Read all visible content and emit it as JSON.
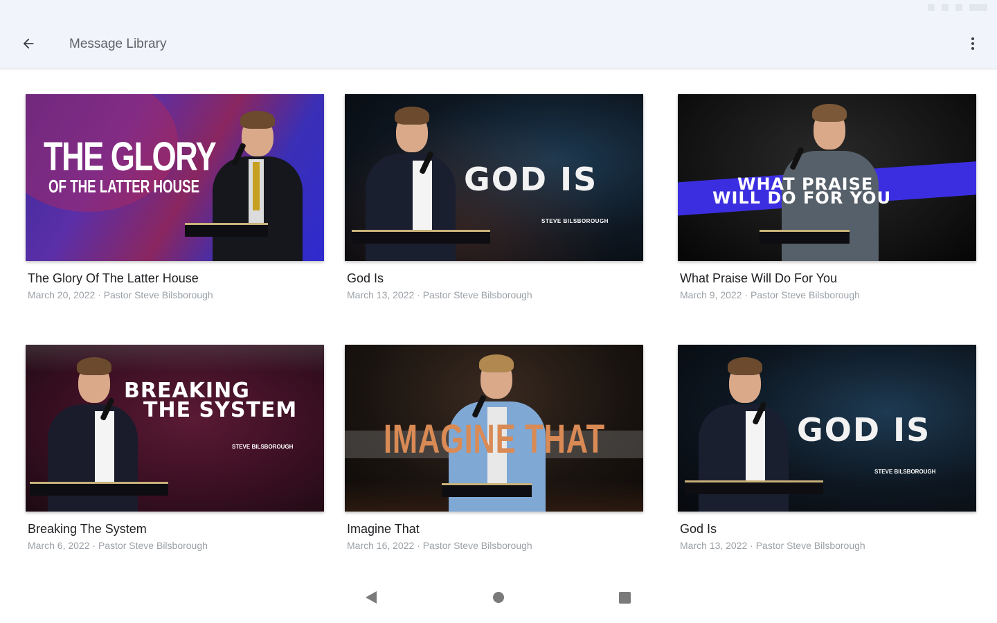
{
  "header": {
    "title": "Message Library"
  },
  "messages": [
    {
      "title": "The Glory Of The Latter House",
      "meta": "March 20, 2022 · Pastor Steve Bilsborough",
      "thumb_line1": "THE GLORY",
      "thumb_line2": "OF THE LATTER HOUSE"
    },
    {
      "title": "God Is",
      "meta": "March 13, 2022 · Pastor Steve Bilsborough",
      "thumb_line1": "GOD IS",
      "thumb_sub": "STEVE BILSBOROUGH"
    },
    {
      "title": "What Praise Will Do For You",
      "meta": "March 9, 2022 · Pastor Steve Bilsborough",
      "thumb_line1": "WHAT PRAISE",
      "thumb_line2": "WILL DO FOR YOU"
    },
    {
      "title": "Breaking The System",
      "meta": "March 6, 2022 · Pastor Steve Bilsborough",
      "thumb_line1": "BREAKING",
      "thumb_line2": "THE SYSTEM",
      "thumb_sub": "STEVE BILSBOROUGH"
    },
    {
      "title": "Imagine That",
      "meta": "March 16, 2022 · Pastor Steve Bilsborough",
      "thumb_line1": "IMAGINE THAT"
    },
    {
      "title": "God Is",
      "meta": "March 13, 2022 · Pastor Steve Bilsborough",
      "thumb_line1": "GOD IS",
      "thumb_sub": "STEVE BILSBOROUGH"
    }
  ],
  "colors": {
    "app_bar": "#f1f4fb",
    "accent_band": "#3b2ee0",
    "imagine_text": "#d98a55"
  },
  "icons": {
    "back": "arrow-left-icon",
    "more": "more-vert-icon"
  }
}
